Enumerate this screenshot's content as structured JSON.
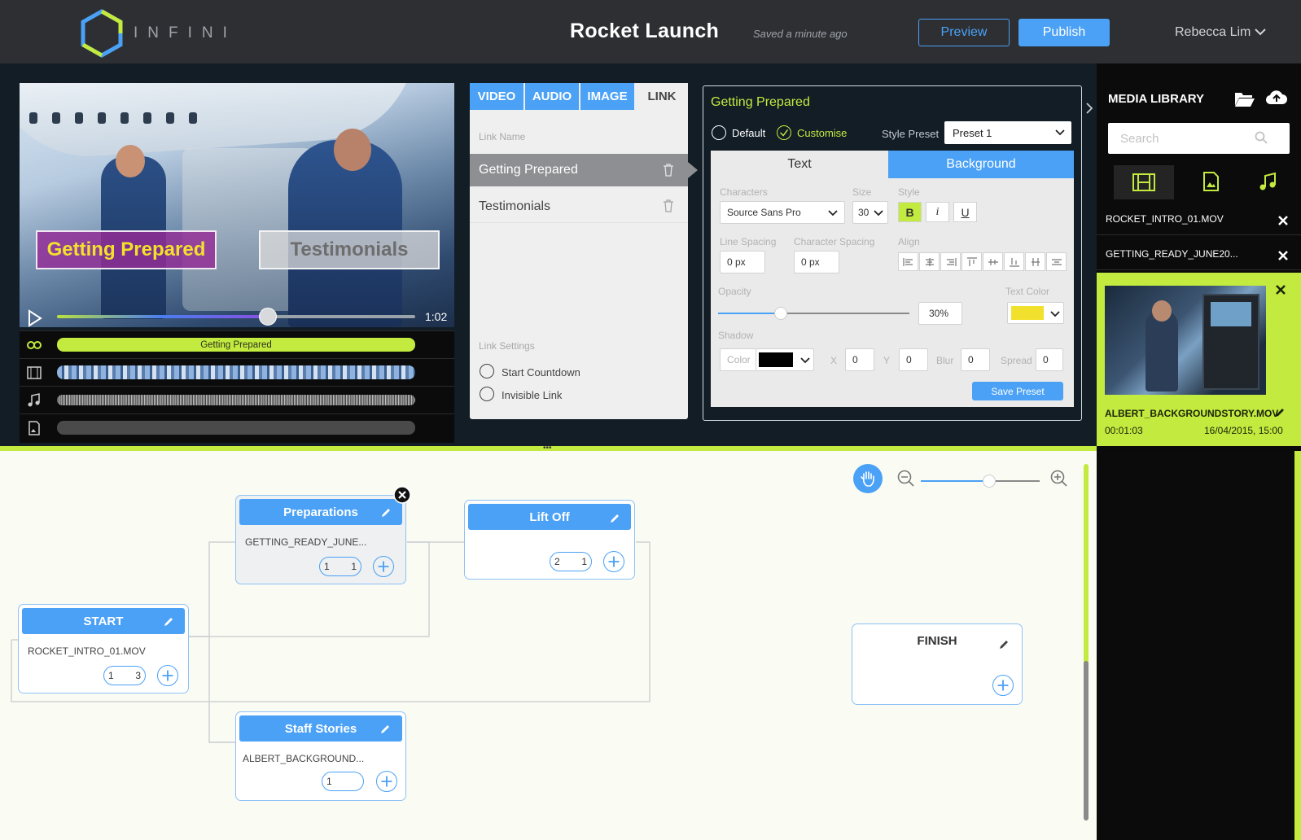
{
  "header": {
    "logo_text": "INFINI",
    "project_title": "Rocket Launch",
    "saved_status": "Saved a minute ago",
    "preview_label": "Preview",
    "publish_label": "Publish",
    "user_name": "Rebecca Lim"
  },
  "player": {
    "overlay_links": [
      "Getting Prepared",
      "Testimonials"
    ],
    "time": "1:02",
    "progress": 0.58,
    "link_track_label": "Getting Prepared"
  },
  "links_panel": {
    "tabs": [
      "VIDEO",
      "AUDIO",
      "IMAGE",
      "LINK"
    ],
    "active_tab": "LINK",
    "link_name_label": "Link Name",
    "links": [
      "Getting Prepared",
      "Testimonials"
    ],
    "selected_link": "Getting Prepared",
    "link_settings_label": "Link Settings",
    "settings": [
      "Start Countdown",
      "Invisible Link"
    ]
  },
  "properties": {
    "title": "Getting Prepared",
    "default_label": "Default",
    "customise_label": "Customise",
    "style_preset_label": "Style Preset",
    "style_preset_value": "Preset 1",
    "tabs": [
      "Text",
      "Background"
    ],
    "active_tab": "Background",
    "characters_label": "Characters",
    "font_value": "Source Sans Pro",
    "size_label": "Size",
    "size_value": "30",
    "style_label": "Style",
    "bold": "B",
    "italic": "i",
    "underline": "U",
    "line_spacing_label": "Line Spacing",
    "line_spacing_value": "0 px",
    "char_spacing_label": "Character Spacing",
    "char_spacing_value": "0 px",
    "align_label": "Align",
    "opacity_label": "Opacity",
    "opacity_value": "30%",
    "opacity_fraction": 0.3,
    "text_color_label": "Text Color",
    "text_color": "#f2e12c",
    "shadow_label": "Shadow",
    "shadow_color_label": "Color",
    "shadow_color": "#000000",
    "shadow_x_label": "X",
    "shadow_x": "0",
    "shadow_y_label": "Y",
    "shadow_y": "0",
    "shadow_blur_label": "Blur",
    "shadow_blur": "0",
    "shadow_spread_label": "Spread",
    "shadow_spread": "0",
    "save_preset_label": "Save Preset"
  },
  "media_library": {
    "title": "MEDIA LIBRARY",
    "search_placeholder": "Search",
    "items": [
      "ROCKET_INTRO_01.MOV",
      "GETTING_READY_JUNE20..."
    ],
    "selected": {
      "name": "ALBERT_BACKGROUNDSTORY.MOV",
      "duration": "00:01:03",
      "date": "16/04/2015, 15:00"
    }
  },
  "flow": {
    "zoom_fraction": 0.57,
    "nodes": [
      {
        "title": "START",
        "file": "ROCKET_INTRO_01.MOV",
        "link_from": "1",
        "link_to": "3"
      },
      {
        "title": "Preparations",
        "file": "GETTING_READY_JUNE...",
        "link_from": "1",
        "link_to": "1"
      },
      {
        "title": "Lift Off",
        "file": "",
        "link_from": "2",
        "link_to": "1"
      },
      {
        "title": "Staff Stories",
        "file": "ALBERT_BACKGROUND...",
        "link_from": "1",
        "link_to": ""
      },
      {
        "title": "FINISH",
        "file": "",
        "link_from": "",
        "link_to": ""
      }
    ]
  },
  "colors": {
    "accent_blue": "#4aa1f5",
    "accent_lime": "#c3ea3f",
    "header_bg": "#2d2f33",
    "editor_bg": "#121d26",
    "canvas_bg": "#fafbf3"
  }
}
